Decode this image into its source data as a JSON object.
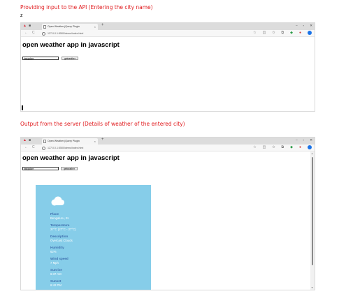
{
  "captions": {
    "input_caption": "Providing input to the API (Entering the city name)",
    "stray_char": "z",
    "output_caption": "Output from the server (Details of weather of the entered city)"
  },
  "browser_chrome": {
    "tab_title": "Open Weather jQuery Plugin",
    "tab_close": "×",
    "new_tab": "+",
    "url": "127.0.0.1:5500/demo/index.html",
    "window_controls": [
      "–",
      "▫",
      "✕"
    ],
    "nav": [
      "←",
      "C"
    ]
  },
  "screen1": {
    "heading": "open weather app in javascript",
    "city_value": "bangalore",
    "button_label": "getweather"
  },
  "screen2": {
    "heading": "open weather app in javascript",
    "city_value": "bangalore",
    "button_label": "getweather",
    "weather": {
      "place_label": "Place",
      "place_value": "Bengaluru, IN",
      "temperature_label": "Temperature",
      "temperature_value": "27°C (27°C - 27°C)",
      "description_label": "Description",
      "description_value": "Overcast Clouds",
      "humidity_label": "Humidity",
      "humidity_value": "62%",
      "wind_label": "Wind speed",
      "wind_value": "7 Mph",
      "sunrise_label": "Sunrise",
      "sunrise_value": "6:37 AM",
      "sunset_label": "Sunset",
      "sunset_value": "6:42 PM"
    }
  },
  "colors": {
    "caption": "#e0191c",
    "card_bg": "#86cde9",
    "label": "#3f6fae"
  },
  "icons": [
    "cloud-icon",
    "star-icon",
    "profile-icon",
    "info-icon"
  ]
}
